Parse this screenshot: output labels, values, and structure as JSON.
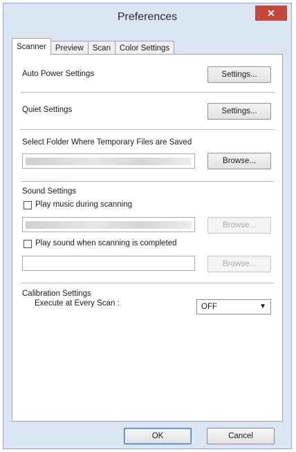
{
  "window": {
    "title": "Preferences",
    "close_glyph": "✕"
  },
  "tabs": [
    {
      "label": "Scanner",
      "active": true
    },
    {
      "label": "Preview",
      "active": false
    },
    {
      "label": "Scan",
      "active": false
    },
    {
      "label": "Color Settings",
      "active": false
    }
  ],
  "auto_power": {
    "label": "Auto Power Settings",
    "button": "Settings..."
  },
  "quiet": {
    "label": "Quiet Settings",
    "button": "Settings..."
  },
  "temp_folder": {
    "label": "Select Folder Where Temporary Files are Saved",
    "button": "Browse..."
  },
  "sound": {
    "label": "Sound Settings",
    "music_checkbox_label": "Play music during scanning",
    "music_checked": false,
    "music_browse": "Browse...",
    "complete_checkbox_label": "Play sound when scanning is completed",
    "complete_checked": false,
    "complete_browse": "Browse..."
  },
  "calibration": {
    "label": "Calibration Settings",
    "execute_label": "Execute at Every Scan :",
    "selected": "OFF"
  },
  "footer": {
    "ok": "OK",
    "cancel": "Cancel"
  },
  "icons": {
    "dropdown": "chevron-down-icon",
    "close": "close-icon"
  }
}
